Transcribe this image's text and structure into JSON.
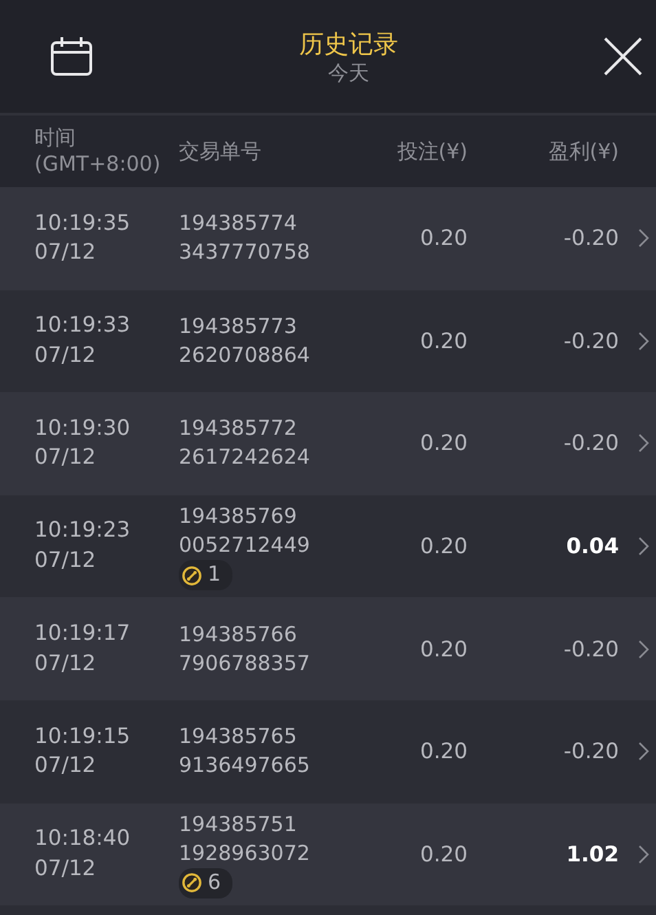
{
  "header": {
    "title": "历史记录",
    "subtitle": "今天"
  },
  "columns": [
    {
      "label": "时间\n(GMT+8:00)"
    },
    {
      "label": "交易单号"
    },
    {
      "label": "投注(¥)"
    },
    {
      "label": "盈利(¥)"
    }
  ],
  "rows": [
    {
      "time": "10:19:35",
      "date": "07/12",
      "order_1": "194385774",
      "order_2": "3437770758",
      "bet": "0.20",
      "profit": "-0.20",
      "win": false
    },
    {
      "time": "10:19:33",
      "date": "07/12",
      "order_1": "194385773",
      "order_2": "2620708864",
      "bet": "0.20",
      "profit": "-0.20",
      "win": false
    },
    {
      "time": "10:19:30",
      "date": "07/12",
      "order_1": "194385772",
      "order_2": "2617242624",
      "bet": "0.20",
      "profit": "-0.20",
      "win": false
    },
    {
      "time": "10:19:23",
      "date": "07/12",
      "order_1": "194385769",
      "order_2": "0052712449",
      "badge": "1",
      "bet": "0.20",
      "profit": "0.04",
      "win": true
    },
    {
      "time": "10:19:17",
      "date": "07/12",
      "order_1": "194385766",
      "order_2": "7906788357",
      "bet": "0.20",
      "profit": "-0.20",
      "win": false
    },
    {
      "time": "10:19:15",
      "date": "07/12",
      "order_1": "194385765",
      "order_2": "9136497665",
      "bet": "0.20",
      "profit": "-0.20",
      "win": false
    },
    {
      "time": "10:18:40",
      "date": "07/12",
      "order_1": "194385751",
      "order_2": "1928963072",
      "badge": "6",
      "bet": "0.20",
      "profit": "1.02",
      "win": true
    }
  ]
}
